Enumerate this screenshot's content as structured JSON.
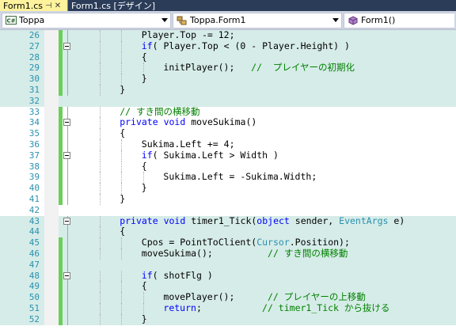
{
  "tabs": [
    {
      "label": "Form1.cs",
      "active": true
    },
    {
      "label": "Form1.cs [デザイン]",
      "active": false
    }
  ],
  "navbar": {
    "project": "Toppa",
    "class": "Toppa.Form1",
    "member": "Form1()"
  },
  "colors": {
    "keyword": "#0000ff",
    "comment": "#008000",
    "type": "#2b91af",
    "line_number": "#2b91af",
    "highlight_band": "#d6ece8",
    "change_marker": "#6ccf59"
  },
  "lines": [
    {
      "n": "26",
      "band": "teal",
      "mod": true,
      "fold": "line",
      "indent": 3,
      "tokens": [
        [
          "t",
          "Player.Top -= 12;"
        ]
      ]
    },
    {
      "n": "27",
      "band": "teal",
      "mod": true,
      "fold": "box",
      "indent": 3,
      "tokens": [
        [
          "k",
          "if"
        ],
        [
          "t",
          "( Player.Top < (0 - Player.Height) )"
        ]
      ]
    },
    {
      "n": "28",
      "band": "teal",
      "mod": true,
      "fold": "line",
      "indent": 3,
      "tokens": [
        [
          "t",
          "{"
        ]
      ]
    },
    {
      "n": "29",
      "band": "teal",
      "mod": true,
      "fold": "line",
      "indent": 4,
      "tokens": [
        [
          "t",
          "initPlayer();   "
        ],
        [
          "c",
          "//  プレイヤーの初期化"
        ]
      ]
    },
    {
      "n": "30",
      "band": "teal",
      "mod": true,
      "fold": "line",
      "indent": 3,
      "tokens": [
        [
          "t",
          "}"
        ]
      ]
    },
    {
      "n": "31",
      "band": "teal",
      "mod": true,
      "fold": "line",
      "indent": 2,
      "tokens": [
        [
          "t",
          "}"
        ]
      ]
    },
    {
      "n": "32",
      "band": "teal",
      "mod": false,
      "fold": "none",
      "indent": 0,
      "tokens": []
    },
    {
      "n": "33",
      "band": "white",
      "mod": true,
      "fold": "line",
      "indent": 2,
      "tokens": [
        [
          "c",
          "// すき間の横移動"
        ]
      ]
    },
    {
      "n": "34",
      "band": "white",
      "mod": true,
      "fold": "box",
      "indent": 2,
      "tokens": [
        [
          "k",
          "private void "
        ],
        [
          "t",
          "moveSukima()"
        ]
      ]
    },
    {
      "n": "35",
      "band": "white",
      "mod": true,
      "fold": "line",
      "indent": 2,
      "tokens": [
        [
          "t",
          "{"
        ]
      ]
    },
    {
      "n": "36",
      "band": "white",
      "mod": true,
      "fold": "line",
      "indent": 3,
      "tokens": [
        [
          "t",
          "Sukima.Left += 4;"
        ]
      ]
    },
    {
      "n": "37",
      "band": "white",
      "mod": true,
      "fold": "box",
      "indent": 3,
      "tokens": [
        [
          "k",
          "if"
        ],
        [
          "t",
          "( Sukima.Left > Width )"
        ]
      ]
    },
    {
      "n": "38",
      "band": "white",
      "mod": true,
      "fold": "line",
      "indent": 3,
      "tokens": [
        [
          "t",
          "{"
        ]
      ]
    },
    {
      "n": "39",
      "band": "white",
      "mod": true,
      "fold": "line",
      "indent": 4,
      "tokens": [
        [
          "t",
          "Sukima.Left = -Sukima.Width;"
        ]
      ]
    },
    {
      "n": "40",
      "band": "white",
      "mod": true,
      "fold": "line",
      "indent": 3,
      "tokens": [
        [
          "t",
          "}"
        ]
      ]
    },
    {
      "n": "41",
      "band": "white",
      "mod": true,
      "fold": "line",
      "indent": 2,
      "tokens": [
        [
          "t",
          "}"
        ]
      ]
    },
    {
      "n": "42",
      "band": "white",
      "mod": false,
      "fold": "none",
      "indent": 0,
      "tokens": []
    },
    {
      "n": "43",
      "band": "teal",
      "mod": false,
      "fold": "box",
      "indent": 2,
      "tokens": [
        [
          "k",
          "private void "
        ],
        [
          "t",
          "timer1_Tick("
        ],
        [
          "k",
          "object "
        ],
        [
          "t",
          "sender, "
        ],
        [
          "y",
          "EventArgs "
        ],
        [
          "t",
          "e)"
        ]
      ]
    },
    {
      "n": "44",
      "band": "teal",
      "mod": false,
      "fold": "line",
      "indent": 2,
      "tokens": [
        [
          "t",
          "{"
        ]
      ]
    },
    {
      "n": "45",
      "band": "teal",
      "mod": true,
      "fold": "line",
      "indent": 3,
      "tokens": [
        [
          "t",
          "Cpos = PointToClient("
        ],
        [
          "y",
          "Cursor"
        ],
        [
          "t",
          ".Position);"
        ]
      ]
    },
    {
      "n": "46",
      "band": "teal",
      "mod": true,
      "fold": "line",
      "indent": 3,
      "tokens": [
        [
          "t",
          "moveSukima();          "
        ],
        [
          "c",
          "// すき間の横移動"
        ]
      ]
    },
    {
      "n": "47",
      "band": "teal",
      "mod": true,
      "fold": "line",
      "indent": 0,
      "tokens": []
    },
    {
      "n": "48",
      "band": "teal",
      "mod": true,
      "fold": "box",
      "indent": 3,
      "tokens": [
        [
          "k",
          "if"
        ],
        [
          "t",
          "( shotFlg )"
        ]
      ]
    },
    {
      "n": "49",
      "band": "teal",
      "mod": true,
      "fold": "line",
      "indent": 3,
      "tokens": [
        [
          "t",
          "{"
        ]
      ]
    },
    {
      "n": "50",
      "band": "teal",
      "mod": true,
      "fold": "line",
      "indent": 4,
      "tokens": [
        [
          "t",
          "movePlayer();      "
        ],
        [
          "c",
          "// プレイヤーの上移動"
        ]
      ]
    },
    {
      "n": "51",
      "band": "teal",
      "mod": true,
      "fold": "line",
      "indent": 4,
      "tokens": [
        [
          "k",
          "return"
        ],
        [
          "t",
          ";           "
        ],
        [
          "c",
          "// timer1_Tick から抜ける"
        ]
      ]
    },
    {
      "n": "52",
      "band": "teal",
      "mod": true,
      "fold": "line",
      "indent": 3,
      "tokens": [
        [
          "t",
          "}"
        ]
      ]
    }
  ]
}
